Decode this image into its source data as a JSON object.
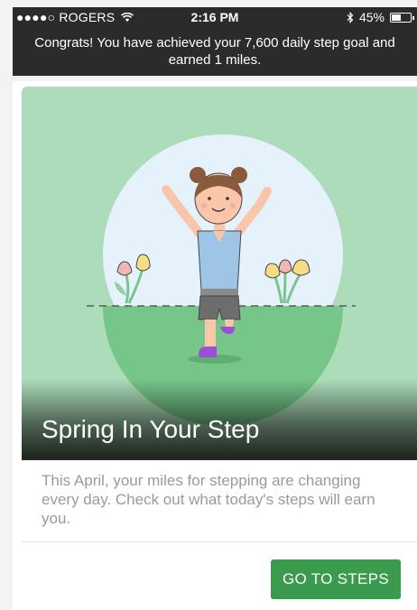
{
  "status_bar": {
    "carrier": "●●●●○ ROGERS",
    "time": "2:16 PM",
    "battery": "45%",
    "battery_level": 0.45
  },
  "banner": {
    "message": "Congrats! You have achieved your 7,600 daily step goal and earned 1 miles."
  },
  "card": {
    "title": "Spring In Your Step",
    "description": "This April, your miles for stepping are changing every day. Check out what today's steps will earn you.",
    "button_label": "GO TO STEPS"
  },
  "colors": {
    "hero_background": "#acdcb9",
    "button": "#3a9a4d",
    "banner": "#2b2b2b"
  },
  "icons": [
    "wifi-icon",
    "bluetooth-icon",
    "battery-icon"
  ]
}
